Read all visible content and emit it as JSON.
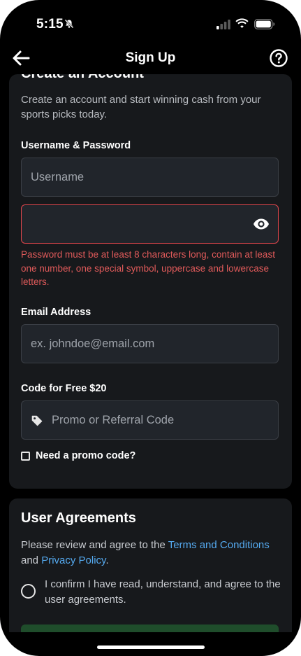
{
  "status_bar": {
    "time": "5:15"
  },
  "nav": {
    "title": "Sign Up"
  },
  "account": {
    "title": "Create an Account",
    "intro": "Create an account and start winning cash from your sports picks today.",
    "credentials_label": "Username & Password",
    "username_placeholder": "Username",
    "password_value": "",
    "password_error": "Password must be at least 8 characters long, contain at least one number, one special symbol, uppercase and lowercase letters.",
    "email_label": "Email Address",
    "email_placeholder": "ex. johndoe@email.com",
    "promo_label": "Code for Free $20",
    "promo_placeholder": "Promo or Referral Code",
    "promo_checkbox_label": "Need a promo code?"
  },
  "agreements": {
    "title": "User Agreements",
    "text_prefix": "Please review and agree to the ",
    "terms_link": "Terms and Conditions",
    "text_middle": " and ",
    "privacy_link": "Privacy Policy",
    "text_suffix": ".",
    "confirm_text": "I confirm I have read, understand, and agree to the user agreements."
  },
  "colors": {
    "background": "#000000",
    "card": "#17191c",
    "field": "#21252b",
    "error": "#e0464c",
    "link": "#55aaf0",
    "primary_button": "#1f4d2b"
  },
  "icons": [
    "bell-slash-icon",
    "signal-icon",
    "wifi-icon",
    "battery-icon",
    "back-arrow-icon",
    "help-icon",
    "eye-icon",
    "tag-icon"
  ]
}
